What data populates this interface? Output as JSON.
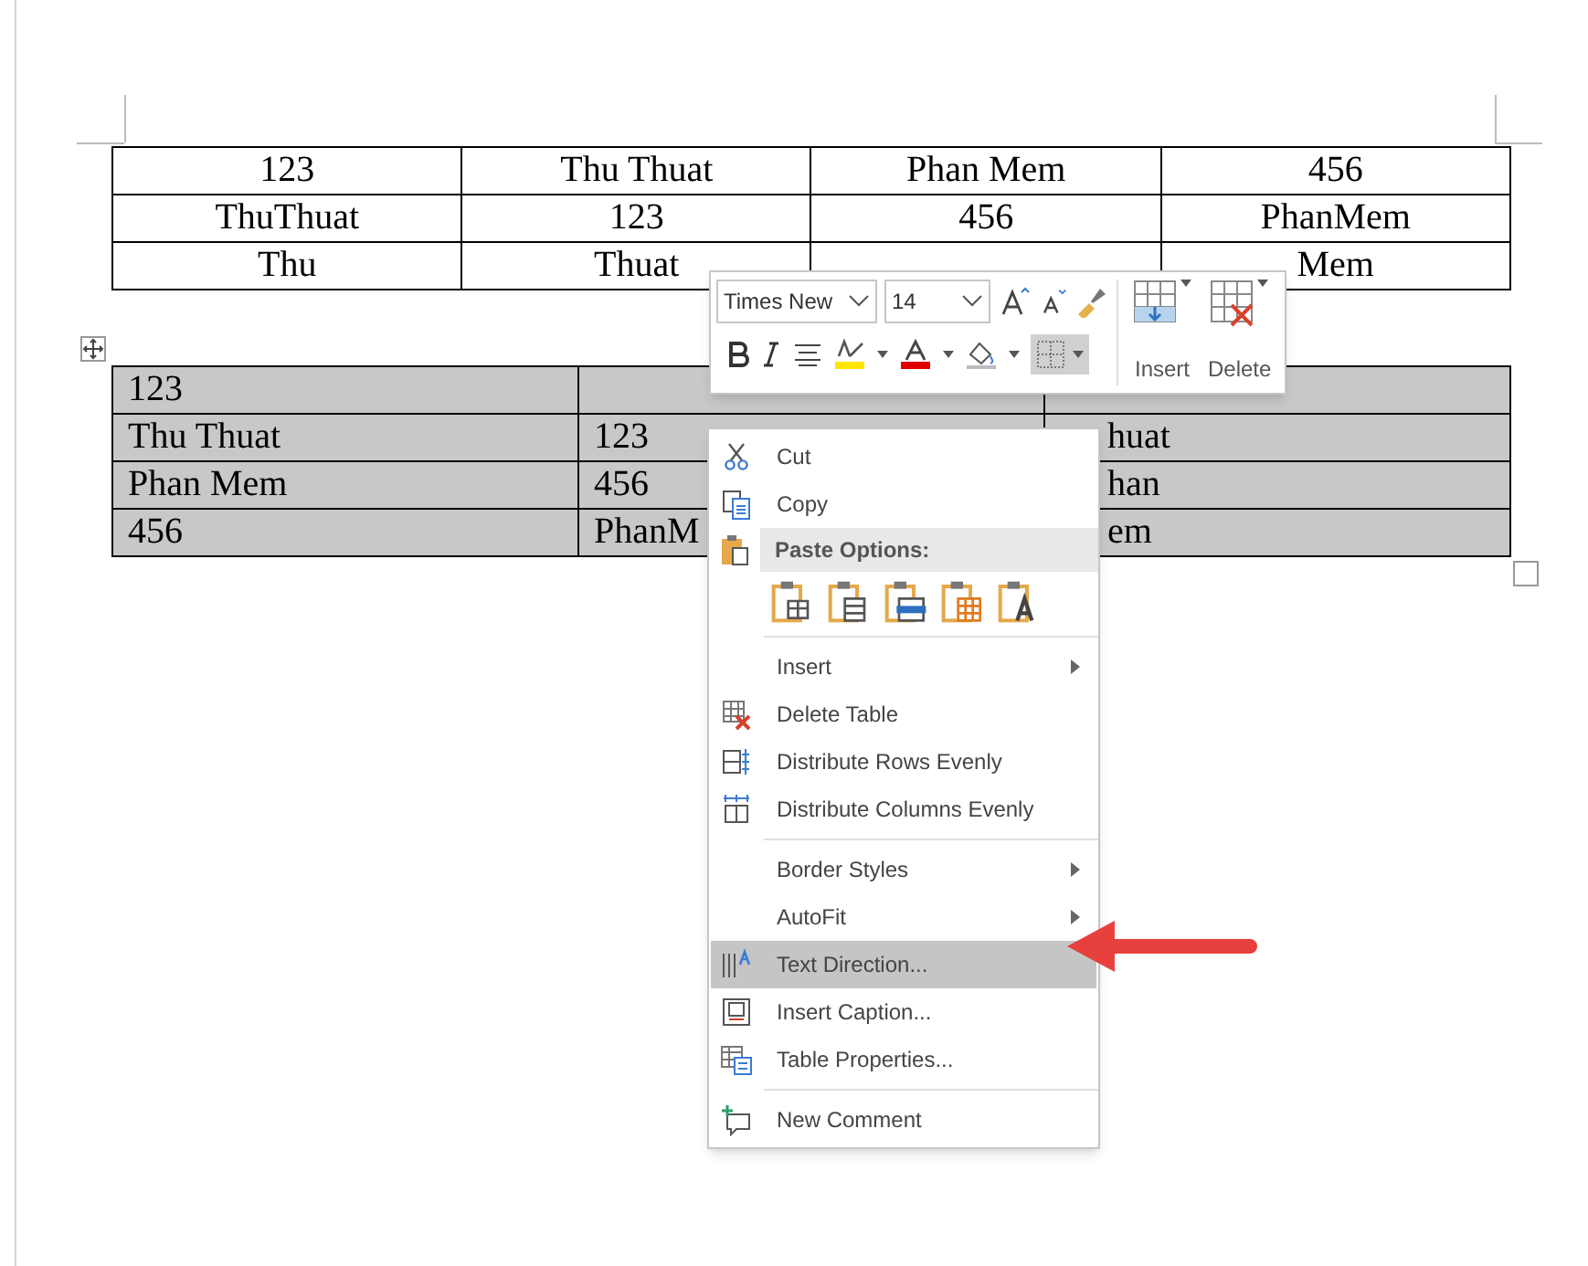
{
  "tables": [
    {
      "selected": false,
      "rows": [
        [
          "123",
          "Thu Thuat",
          "Phan Mem",
          "456"
        ],
        [
          "ThuThuat",
          "123",
          "456",
          "PhanMem"
        ],
        [
          "Thu",
          "Thuat",
          null,
          "Mem"
        ]
      ]
    },
    {
      "selected": true,
      "rows": [
        [
          "123",
          null,
          null
        ],
        [
          "Thu Thuat",
          "123",
          "huat"
        ],
        [
          "Phan Mem",
          "456",
          "han"
        ],
        [
          "456",
          "PhanM",
          "em"
        ]
      ]
    }
  ],
  "mini_toolbar": {
    "font_name": "Times New",
    "font_size": "14",
    "buttons": [
      "Insert",
      "Delete"
    ]
  },
  "context_menu": {
    "items": [
      {
        "kind": "command",
        "label": "Cut",
        "submenu": false,
        "highlighted": false
      },
      {
        "kind": "command",
        "label": "Copy",
        "submenu": false,
        "highlighted": false
      },
      {
        "kind": "header",
        "label": "Paste Options:"
      },
      {
        "kind": "paste_options"
      },
      {
        "kind": "separator"
      },
      {
        "kind": "command",
        "label": "Insert",
        "submenu": true,
        "highlighted": false
      },
      {
        "kind": "command",
        "label": "Delete Table",
        "submenu": false,
        "highlighted": false
      },
      {
        "kind": "command",
        "label": "Distribute Rows Evenly",
        "submenu": false,
        "highlighted": false
      },
      {
        "kind": "command",
        "label": "Distribute Columns Evenly",
        "submenu": false,
        "highlighted": false
      },
      {
        "kind": "separator"
      },
      {
        "kind": "command",
        "label": "Border Styles",
        "submenu": true,
        "highlighted": false
      },
      {
        "kind": "command",
        "label": "AutoFit",
        "submenu": true,
        "highlighted": false
      },
      {
        "kind": "command",
        "label": "Text Direction...",
        "submenu": false,
        "highlighted": true
      },
      {
        "kind": "command",
        "label": "Insert Caption...",
        "submenu": false,
        "highlighted": false
      },
      {
        "kind": "command",
        "label": "Table Properties...",
        "submenu": false,
        "highlighted": false
      },
      {
        "kind": "separator"
      },
      {
        "kind": "command",
        "label": "New Comment",
        "submenu": false,
        "highlighted": false
      }
    ]
  }
}
